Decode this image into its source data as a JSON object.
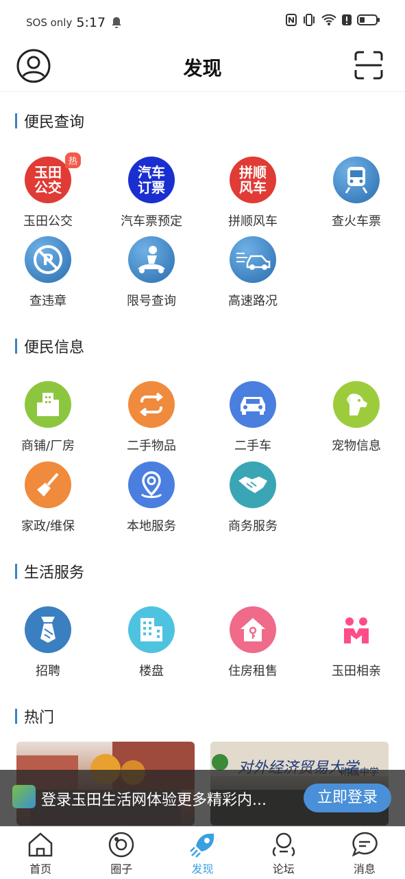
{
  "status_bar": {
    "carrier": "SOS only",
    "time": "5:17"
  },
  "header": {
    "title": "发现"
  },
  "sections": [
    {
      "title": "便民查询",
      "items": [
        {
          "label": "玉田公交",
          "icon": "yutian-bus-icon",
          "logo_text": "玉田\n公交",
          "color": "#e03b35",
          "badge": "热"
        },
        {
          "label": "汽车票预定",
          "icon": "bus-ticket-icon",
          "logo_text": "汽车\n订票",
          "color": "#1a2fd0"
        },
        {
          "label": "拼顺风车",
          "icon": "carpool-icon",
          "logo_text": "拼顺\n风车",
          "color": "#e03b35"
        },
        {
          "label": "查火车票",
          "icon": "train-icon",
          "color": "#3a7fc0"
        },
        {
          "label": "查违章",
          "icon": "no-parking-icon",
          "color": "#3a7fc0"
        },
        {
          "label": "限号查询",
          "icon": "plate-limit-icon",
          "color": "#3a7fc0"
        },
        {
          "label": "高速路况",
          "icon": "highway-car-icon",
          "color": "#3a7fc0"
        }
      ]
    },
    {
      "title": "便民信息",
      "items": [
        {
          "label": "商铺/厂房",
          "icon": "building-icon",
          "color": "#8cc63f"
        },
        {
          "label": "二手物品",
          "icon": "exchange-icon",
          "color": "#f08a3c"
        },
        {
          "label": "二手车",
          "icon": "car-icon",
          "color": "#4a7fe0"
        },
        {
          "label": "宠物信息",
          "icon": "dog-icon",
          "color": "#9ccc3c"
        },
        {
          "label": "家政/维保",
          "icon": "broom-icon",
          "color": "#f08a3c"
        },
        {
          "label": "本地服务",
          "icon": "location-pin-icon",
          "color": "#4a7fe0"
        },
        {
          "label": "商务服务",
          "icon": "handshake-icon",
          "color": "#3aa5b5"
        }
      ]
    },
    {
      "title": "生活服务",
      "items": [
        {
          "label": "招聘",
          "icon": "tie-icon",
          "color": "#3a7fc0"
        },
        {
          "label": "楼盘",
          "icon": "apartment-icon",
          "color": "#4ec3e0"
        },
        {
          "label": "住房租售",
          "icon": "house-key-icon",
          "color": "#f06a8a"
        },
        {
          "label": "玉田相亲",
          "icon": "couple-icon",
          "color": "#ff4d8a"
        }
      ]
    },
    {
      "title": "热门",
      "items": []
    }
  ],
  "hot_images": {
    "right_caption": "对外经济贸易大学",
    "right_caption2": "附属中学"
  },
  "login_banner": {
    "text": "登录玉田生活网体验更多精彩内...",
    "button": "立即登录"
  },
  "tabbar": [
    {
      "label": "首页",
      "icon": "home-icon"
    },
    {
      "label": "圈子",
      "icon": "circle-icon"
    },
    {
      "label": "发现",
      "icon": "rocket-icon",
      "active": true
    },
    {
      "label": "论坛",
      "icon": "forum-icon"
    },
    {
      "label": "消息",
      "icon": "message-icon"
    }
  ]
}
